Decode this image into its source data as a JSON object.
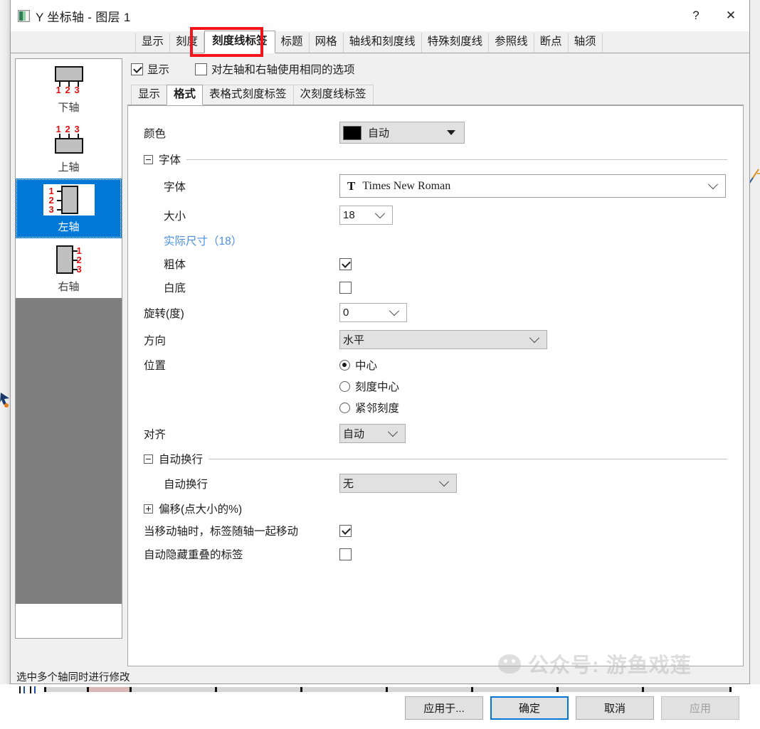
{
  "window": {
    "title": "Y 坐标轴 - 图层 1",
    "icon": "axis-dialog-icon",
    "help_label": "?",
    "close_label": "✕"
  },
  "tabs": [
    {
      "label": "显示",
      "active": false
    },
    {
      "label": "刻度",
      "active": false
    },
    {
      "label": "刻度线标签",
      "active": true
    },
    {
      "label": "标题",
      "active": false
    },
    {
      "label": "网格",
      "active": false
    },
    {
      "label": "轴线和刻度线",
      "active": false
    },
    {
      "label": "特殊刻度线",
      "active": false
    },
    {
      "label": "参照线",
      "active": false
    },
    {
      "label": "断点",
      "active": false
    },
    {
      "label": "轴须",
      "active": false
    }
  ],
  "highlight_color": "#f4141b",
  "axis_list": [
    {
      "label": "下轴",
      "selected": false,
      "glyph": "bottom-axis-icon"
    },
    {
      "label": "上轴",
      "selected": false,
      "glyph": "top-axis-icon"
    },
    {
      "label": "左轴",
      "selected": true,
      "glyph": "left-axis-icon"
    },
    {
      "label": "右轴",
      "selected": false,
      "glyph": "right-axis-icon"
    }
  ],
  "top_checkboxes": [
    {
      "label": "显示",
      "checked": true
    },
    {
      "label": "对左轴和右轴使用相同的选项",
      "checked": false
    }
  ],
  "inner_tabs": [
    {
      "label": "显示",
      "active": false
    },
    {
      "label": "格式",
      "active": true
    },
    {
      "label": "表格式刻度标签",
      "active": false
    },
    {
      "label": "次刻度线标签",
      "active": false
    }
  ],
  "form": {
    "color": {
      "label": "颜色",
      "value": "自动",
      "swatch_hex": "#000000"
    },
    "font_group": {
      "label": "字体",
      "expanded": true
    },
    "font": {
      "label": "字体",
      "value": "Times New Roman",
      "icon": "font-glyph-icon"
    },
    "size": {
      "label": "大小",
      "value": "18"
    },
    "actual_size": {
      "label": "实际尺寸（18）",
      "color": "#4a90e2"
    },
    "bold": {
      "label": "粗体",
      "checked": true
    },
    "white_bg": {
      "label": "白底",
      "checked": false
    },
    "rotation": {
      "label": "旋转(度)",
      "value": "0"
    },
    "direction": {
      "label": "方向",
      "value": "水平"
    },
    "position": {
      "label": "位置",
      "options": [
        {
          "label": "中心",
          "selected": true
        },
        {
          "label": "刻度中心",
          "selected": false
        },
        {
          "label": "紧邻刻度",
          "selected": false
        }
      ]
    },
    "align": {
      "label": "对齐",
      "value": "自动"
    },
    "wrap_group": {
      "label": "自动换行",
      "expanded": true
    },
    "wrap": {
      "label": "自动换行",
      "value": "无"
    },
    "offset_group": {
      "label": "偏移(点大小的%)",
      "expanded": false
    },
    "move_with_axis": {
      "label": "当移动轴时，标签随轴一起移动",
      "checked": true
    },
    "auto_hide_overlap": {
      "label": "自动隐藏重叠的标签",
      "checked": false
    }
  },
  "status_text": "选中多个轴同时进行修改",
  "footer_buttons": [
    {
      "label": "应用于...",
      "style": "normal"
    },
    {
      "label": "确定",
      "style": "primary"
    },
    {
      "label": "取消",
      "style": "normal"
    },
    {
      "label": "应用",
      "style": "disabled"
    }
  ],
  "watermark": {
    "text": "公众号: 游鱼戏莲",
    "logo": "wechat-logo-icon"
  }
}
